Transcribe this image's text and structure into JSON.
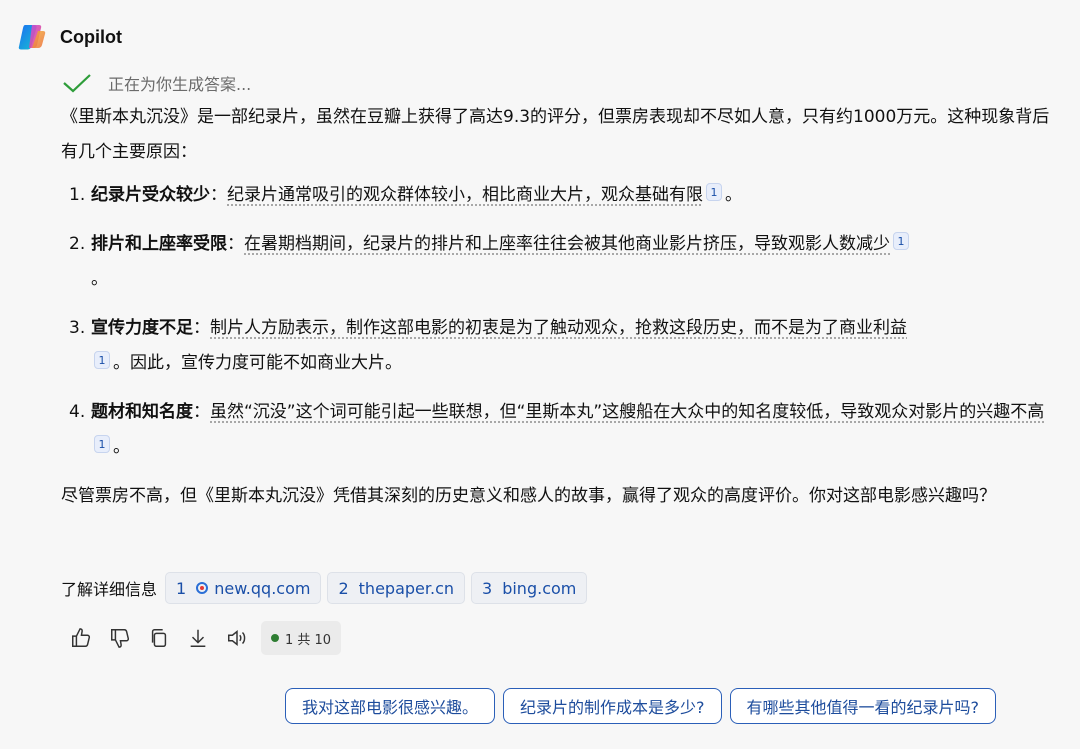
{
  "app": {
    "name": "Copilot"
  },
  "status": {
    "text": "正在为你生成答案..."
  },
  "answer": {
    "intro": "《里斯本丸沉没》是一部纪录片，虽然在豆瓣上获得了高达9.3的评分，但票房表现却不尽如人意，只有约1000万元。这种现象背后有几个主要原因：",
    "items": [
      {
        "num": "1.",
        "title": "纪录片受众较少",
        "sep": "：",
        "text": "纪录片通常吸引的观众群体较小，相比商业大片，观众基础有限",
        "cite": "1",
        "tail": "。"
      },
      {
        "num": "2.",
        "title": "排片和上座率受限",
        "sep": "：",
        "text": "在暑期档期间，纪录片的排片和上座率往往会被其他商业影片挤压，导致观影人数减少",
        "cite": "1",
        "tail": "。"
      },
      {
        "num": "3.",
        "title": "宣传力度不足",
        "sep": "：",
        "text": "制片人方励表示，制作这部电影的初衷是为了触动观众，抢救这段历史，而不是为了商业利益",
        "cite": "1",
        "tail": "。因此，宣传力度可能不如商业大片。"
      },
      {
        "num": "4.",
        "title": "题材和知名度",
        "sep": "：",
        "text": "虽然“沉没”这个词可能引起一些联想，但“里斯本丸”这艘船在大众中的知名度较低，导致观众对影片的兴趣不高",
        "cite": "1",
        "tail": "。"
      }
    ],
    "outro": "尽管票房不高，但《里斯本丸沉没》凭借其深刻的历史意义和感人的故事，赢得了观众的高度评价。你对这部电影感兴趣吗？"
  },
  "sources": {
    "label": "了解详细信息",
    "items": [
      {
        "num": "1",
        "domain": "new.qq.com"
      },
      {
        "num": "2",
        "domain": "thepaper.cn"
      },
      {
        "num": "3",
        "domain": "bing.com"
      }
    ]
  },
  "counter": {
    "text": "1 共 10",
    "dot_color": "#2e7d32"
  },
  "icons": [
    "thumbs-up-icon",
    "thumbs-down-icon",
    "copy-icon",
    "download-icon",
    "speaker-icon",
    "check-icon"
  ],
  "suggestions": [
    "我对这部电影很感兴趣。",
    "纪录片的制作成本是多少?",
    "有哪些其他值得一看的纪录片吗?"
  ]
}
